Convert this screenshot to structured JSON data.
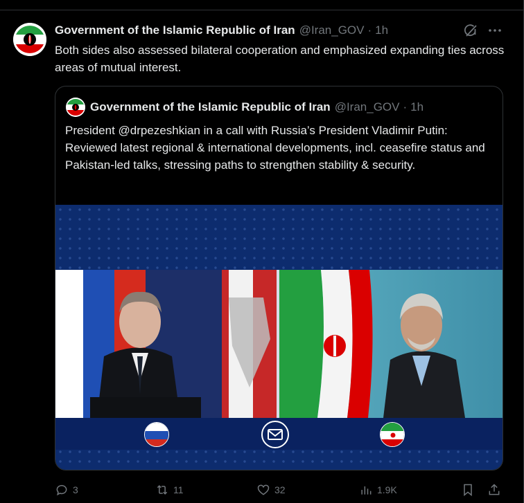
{
  "tweet": {
    "author_name": "Government of the Islamic Republic of Iran",
    "handle": "@Iran_GOV",
    "separator": "·",
    "time": "1h",
    "text": "Both sides also assessed bilateral cooperation and emphasized expanding ties across areas of mutual interest."
  },
  "quoted": {
    "author_name": "Government of the Islamic Republic of Iran",
    "handle": "@Iran_GOV",
    "separator": "·",
    "time": "1h",
    "text": "President @drpezeshkian in a call with Russia’s President Vladimir Putin: Reviewed latest regional & international developments, incl. ceasefire status and Pakistan-led talks, stressing paths to strengthen stability & security."
  },
  "actions": {
    "replies": "3",
    "reposts": "11",
    "likes": "32",
    "views": "1.9K"
  },
  "icons": {
    "grok": "grok-icon",
    "more": "more-icon",
    "reply": "reply-icon",
    "repost": "repost-icon",
    "like": "like-icon",
    "views": "views-icon",
    "bookmark": "bookmark-icon",
    "share": "share-icon",
    "mail": "mail-icon"
  },
  "colors": {
    "background": "#000000",
    "text": "#e7e9ea",
    "muted": "#71767b",
    "border": "#2f3336",
    "media_blue": "#0d2c6e"
  }
}
